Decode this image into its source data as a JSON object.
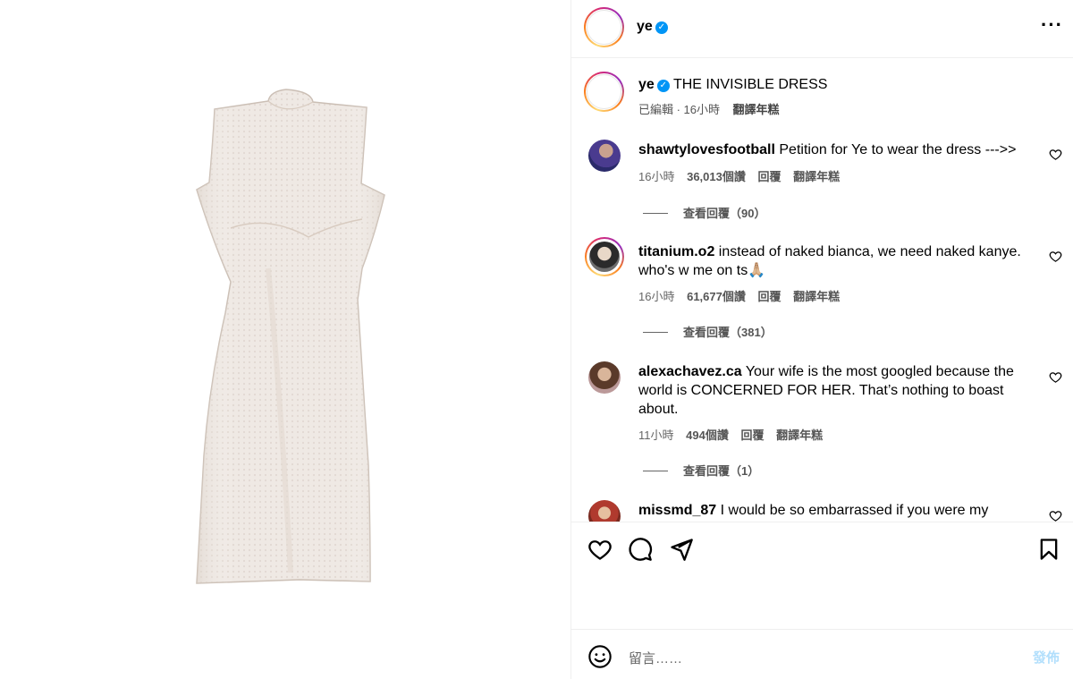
{
  "post": {
    "username": "ye",
    "caption_text": "THE INVISIBLE DRESS",
    "caption_edited": "已編輯 · 16小時",
    "caption_translate": "翻譯年糕"
  },
  "comments": [
    {
      "username": "shawtylovesfootball",
      "text": "Petition for Ye to wear the dress --->>",
      "time": "16小時",
      "likes": "36,013個讚",
      "reply": "回覆",
      "translate": "翻譯年糕",
      "view_replies": "查看回覆（90）"
    },
    {
      "username": "titanium.o2",
      "text": "instead of naked bianca, we need naked kanye. who's w me on ts🙏🏼",
      "time": "16小時",
      "likes": "61,677個讚",
      "reply": "回覆",
      "translate": "翻譯年糕",
      "view_replies": "查看回覆（381）"
    },
    {
      "username": "alexachavez.ca",
      "text": "Your wife is the most googled because the world is CONCERNED FOR HER. That’s nothing to boast about.",
      "time": "11小時",
      "likes": "494個讚",
      "reply": "回覆",
      "translate": "翻譯年糕",
      "view_replies": "查看回覆（1）"
    },
    {
      "username": "missmd_87",
      "text": "I would be so embarrassed if you were my"
    }
  ],
  "icons": {
    "more": "more-options-icon",
    "heart": "heart-icon",
    "comment": "comment-icon",
    "share": "share-icon",
    "save": "bookmark-icon",
    "emoji": "emoji-icon",
    "verified": "verified-badge-icon"
  },
  "composer": {
    "placeholder": "留言……",
    "post_label": "發佈"
  },
  "colors": {
    "accent": "#0095f6",
    "post_disabled": "#b2dffc"
  }
}
